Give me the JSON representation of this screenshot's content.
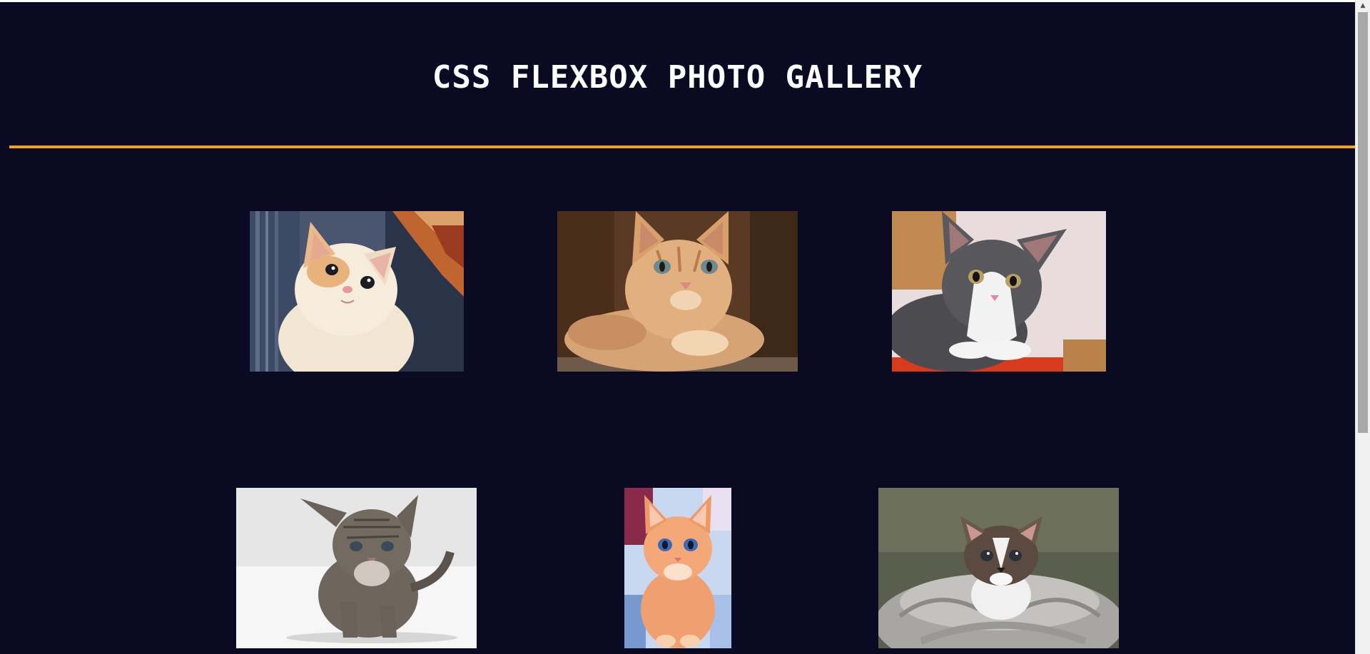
{
  "header": {
    "title": "CSS FLEXBOX PHOTO GALLERY"
  },
  "colors": {
    "background": "#0a0a23",
    "title": "#ffffff",
    "divider": "#f1a02c"
  },
  "gallery": {
    "photos": [
      {
        "name": "kitten-cream-looking-up",
        "icon": "kitten-photo"
      },
      {
        "name": "kitten-orange-tabby-lying",
        "icon": "kitten-photo"
      },
      {
        "name": "kitten-gray-white",
        "icon": "kitten-photo"
      },
      {
        "name": "kitten-tabby-sitting-white-background",
        "icon": "kitten-photo"
      },
      {
        "name": "kitten-orange-fluffy-painting",
        "icon": "kitten-photo"
      },
      {
        "name": "kitten-tabby-in-towel",
        "icon": "kitten-photo"
      }
    ]
  },
  "scrollbar": {
    "up_arrow": "▲"
  }
}
